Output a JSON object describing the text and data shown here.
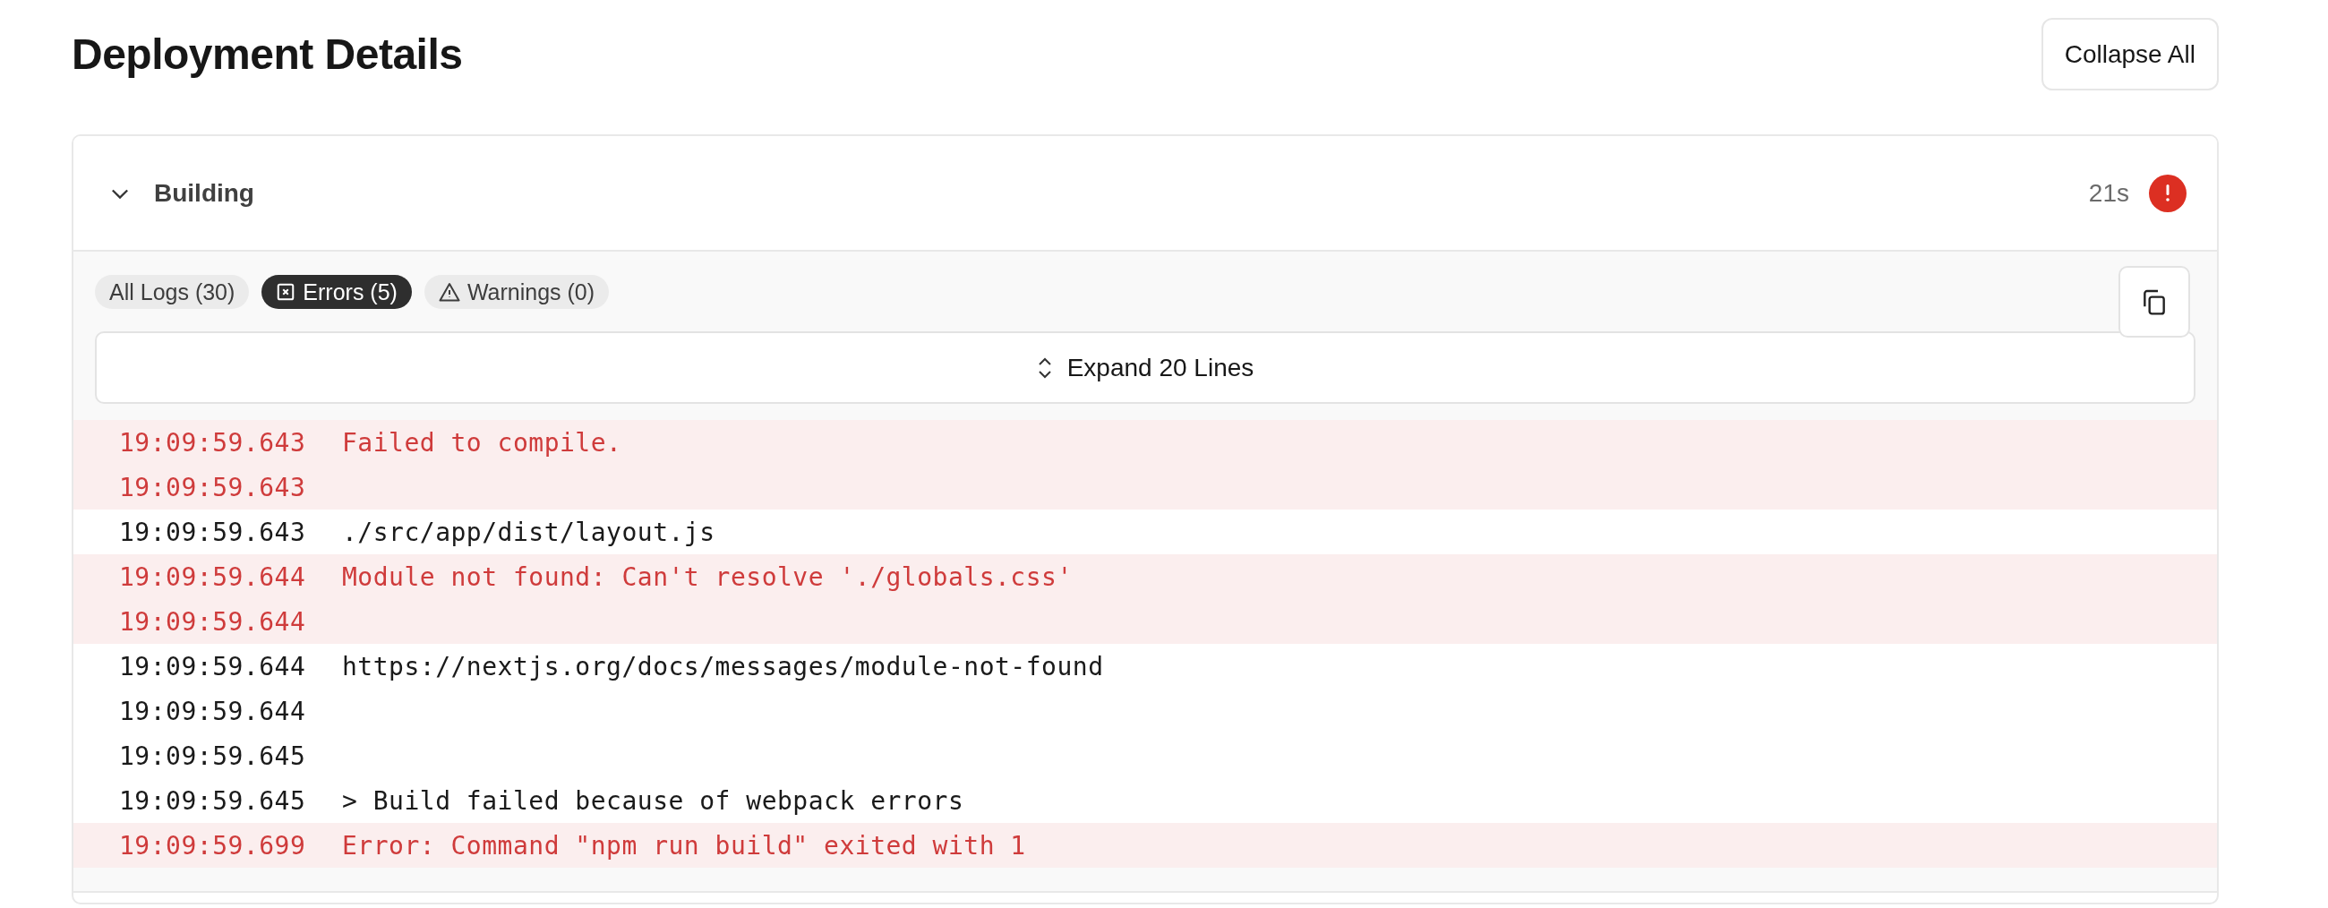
{
  "page": {
    "title": "Deployment Details",
    "collapse_button": "Collapse All"
  },
  "section": {
    "title": "Building",
    "expanded": true,
    "duration": "21s",
    "kind": "error",
    "filters": [
      {
        "label": "All Logs (30)",
        "kind": "all",
        "selected": false
      },
      {
        "label": "Errors (5)",
        "kind": "error",
        "selected": true
      },
      {
        "label": "Warnings (0)",
        "kind": "warning",
        "selected": false
      }
    ],
    "expand_button": "Expand 20 Lines",
    "logs": [
      {
        "time": "19:09:59.643",
        "message": "Failed to compile.",
        "kind": "error"
      },
      {
        "time": "19:09:59.643",
        "kind": "error"
      },
      {
        "time": "19:09:59.643",
        "message": "./src/app/dist/layout.js",
        "kind": "info"
      },
      {
        "time": "19:09:59.644",
        "message": "Module not found: Can't resolve './globals.css'",
        "kind": "error"
      },
      {
        "time": "19:09:59.644",
        "kind": "error"
      },
      {
        "time": "19:09:59.644",
        "message": "https://nextjs.org/docs/messages/module-not-found",
        "kind": "info"
      },
      {
        "time": "19:09:59.644",
        "kind": "info"
      },
      {
        "time": "19:09:59.645",
        "kind": "info"
      },
      {
        "time": "19:09:59.645",
        "message": "> Build failed because of webpack errors",
        "kind": "info"
      },
      {
        "time": "19:09:59.699",
        "message": "Error: Command \"npm run build\" exited with 1",
        "kind": "error"
      }
    ]
  }
}
